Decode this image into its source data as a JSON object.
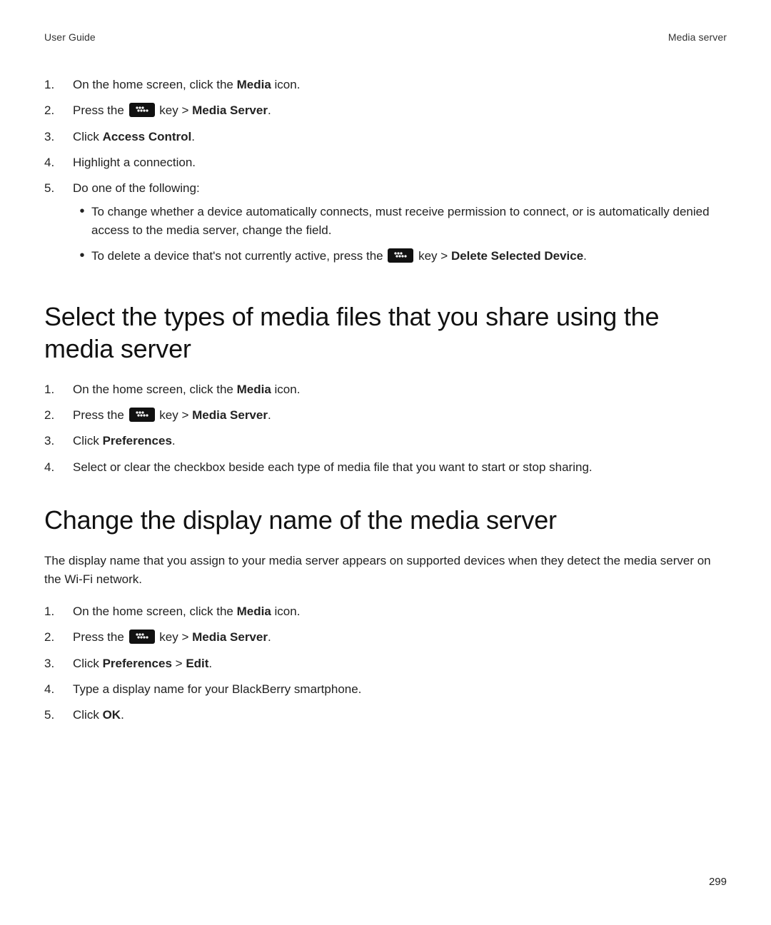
{
  "header": {
    "left": "User Guide",
    "right": "Media server"
  },
  "footer_page": "299",
  "icon_label": "Menu key",
  "strings": {
    "media": "Media",
    "icon_suffix": " icon.",
    "media_server": "Media Server",
    "access_control": "Access Control",
    "preferences": "Preferences",
    "edit": "Edit",
    "ok": "OK",
    "delete_selected": "Delete Selected Device",
    "gt": ">",
    "period": "."
  },
  "sec0": {
    "s1_pre": "On the home screen, click the ",
    "s2_pre": "Press the ",
    "s2_post": " key > ",
    "s3_pre": "Click ",
    "s4": "Highlight a connection.",
    "s5": "Do one of the following:",
    "b1": "To change whether a device automatically connects, must receive permission to connect, or is automatically denied access to the media server, change the field.",
    "b2_pre": "To delete a device that's not currently active, press the ",
    "b2_post": " key > "
  },
  "sec1": {
    "heading": "Select the types of media files that you share using the media server",
    "s1_pre": "On the home screen, click the ",
    "s2_pre": "Press the ",
    "s2_post": " key > ",
    "s3_pre": "Click ",
    "s4": "Select or clear the checkbox beside each type of media file that you want to start or stop sharing."
  },
  "sec2": {
    "heading": "Change the display name of the media server",
    "para": "The display name that you assign to your media server appears on supported devices when they detect the media server on the Wi-Fi network.",
    "s1_pre": "On the home screen, click the ",
    "s2_pre": "Press the ",
    "s2_post": " key > ",
    "s3_pre": "Click ",
    "s4": "Type a display name for your BlackBerry smartphone.",
    "s5_pre": "Click "
  }
}
